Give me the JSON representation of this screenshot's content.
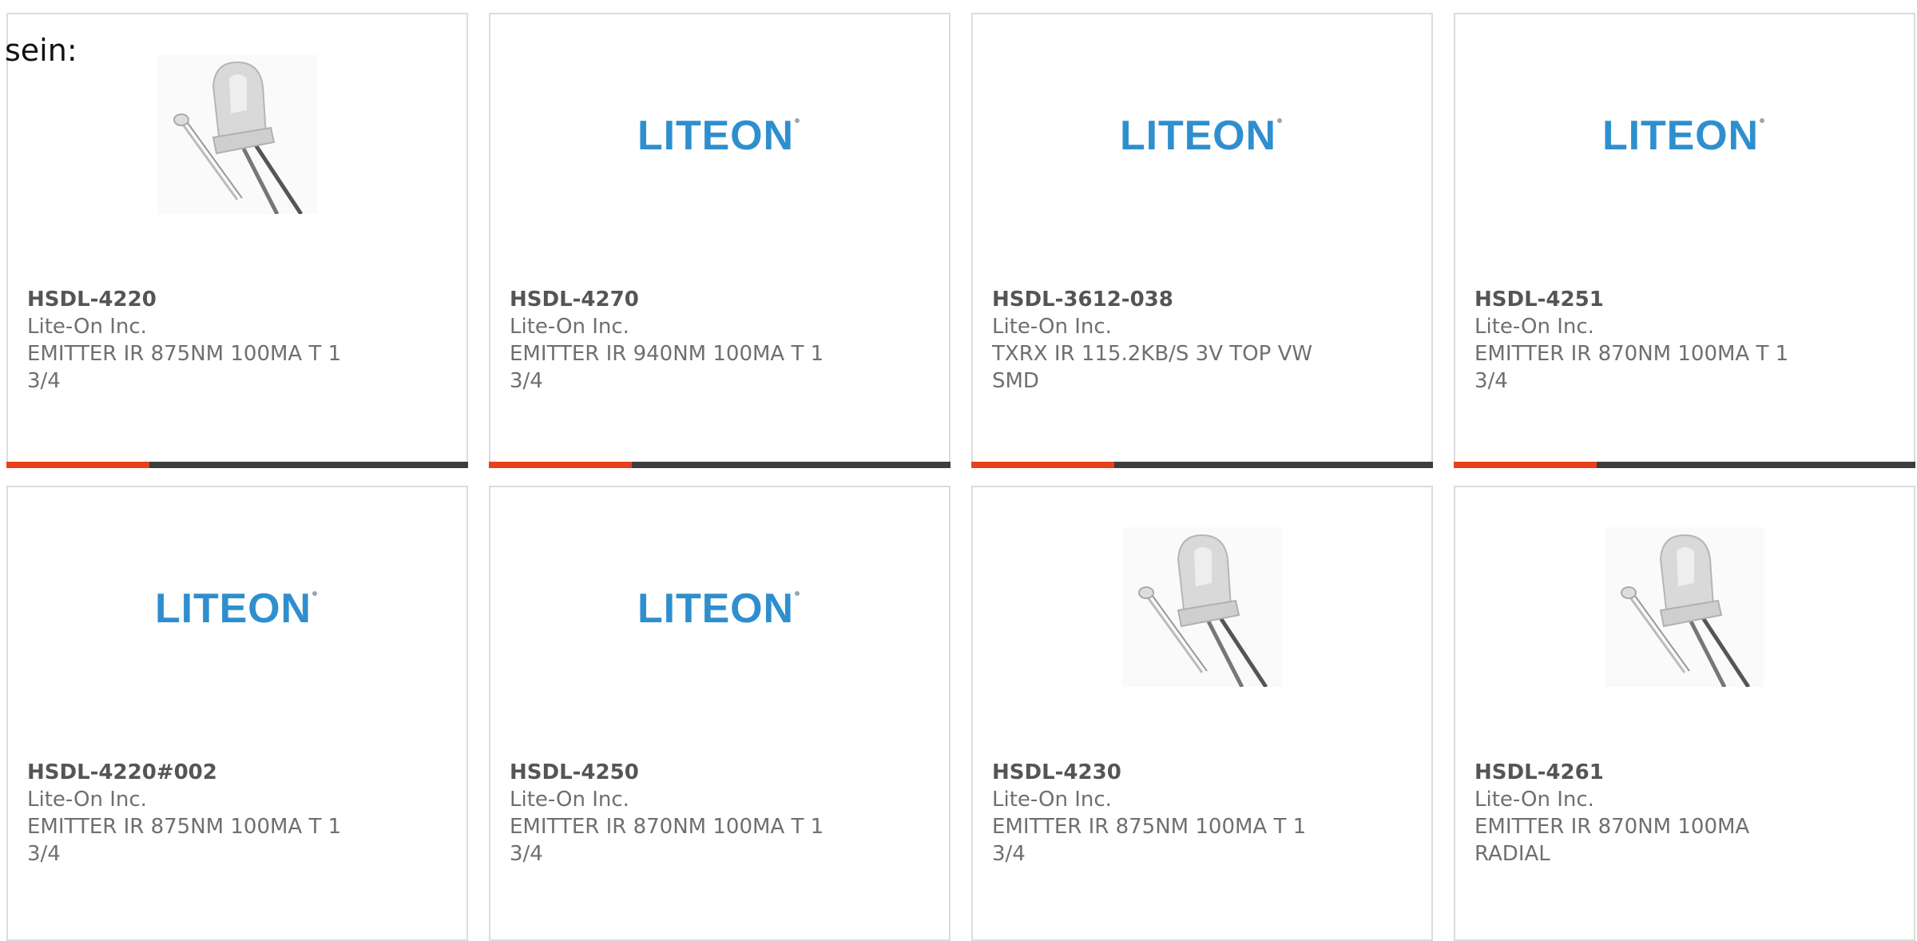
{
  "intro_text": "sein:",
  "colors": {
    "liteon_blue": "#2f8fce",
    "accent_orange": "#e8401c",
    "bar_dark": "#3d3d3d",
    "border": "#dcdcdc"
  },
  "products": [
    {
      "part": "HSDL-4220",
      "maker": "Lite-On Inc.",
      "desc_line1": "EMITTER IR 875NM 100MA T 1",
      "desc_line2": "3/4",
      "image": "led-photo"
    },
    {
      "part": "HSDL-4270",
      "maker": "Lite-On Inc.",
      "desc_line1": "EMITTER IR 940NM 100MA T 1",
      "desc_line2": "3/4",
      "image": "liteon-logo"
    },
    {
      "part": "HSDL-3612-038",
      "maker": "Lite-On Inc.",
      "desc_line1": "TXRX IR 115.2KB/S 3V TOP VW",
      "desc_line2": "SMD",
      "image": "liteon-logo"
    },
    {
      "part": "HSDL-4251",
      "maker": "Lite-On Inc.",
      "desc_line1": "EMITTER IR 870NM 100MA T 1",
      "desc_line2": "3/4",
      "image": "liteon-logo"
    },
    {
      "part": "HSDL-4220#002",
      "maker": "Lite-On Inc.",
      "desc_line1": "EMITTER IR 875NM 100MA T 1",
      "desc_line2": "3/4",
      "image": "liteon-logo"
    },
    {
      "part": "HSDL-4250",
      "maker": "Lite-On Inc.",
      "desc_line1": "EMITTER IR 870NM 100MA T 1",
      "desc_line2": "3/4",
      "image": "liteon-logo"
    },
    {
      "part": "HSDL-4230",
      "maker": "Lite-On Inc.",
      "desc_line1": "EMITTER IR 875NM 100MA T 1",
      "desc_line2": "3/4",
      "image": "led-photo"
    },
    {
      "part": "HSDL-4261",
      "maker": "Lite-On Inc.",
      "desc_line1": "EMITTER IR 870NM 100MA",
      "desc_line2": "RADIAL",
      "image": "led-photo"
    }
  ]
}
